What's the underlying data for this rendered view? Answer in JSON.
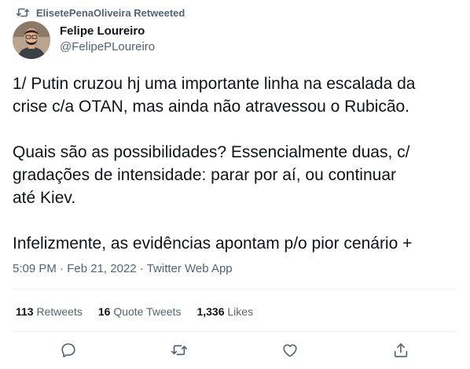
{
  "retweet_context": {
    "text": "ElisetePenaOliveira Retweeted"
  },
  "author": {
    "display_name": "Felipe Loureiro",
    "handle": "@FelipePLoureiro"
  },
  "tweet": {
    "lines": [
      "1/ Putin cruzou hj uma importante linha na escalada da",
      "crise c/a OTAN, mas ainda não atravessou o Rubicão.",
      "Quais são as possibilidades? Essencialmente duas, c/",
      "gradações de intensidade: parar por aí, ou continuar",
      "até Kiev.",
      "Infelizmente, as evidências apontam p/o pior cenário +"
    ]
  },
  "meta": {
    "time": "5:09 PM",
    "separator": "·",
    "date": "Feb 21, 2022",
    "source": "Twitter Web App"
  },
  "stats": {
    "retweets_count": "113",
    "retweets_label": "Retweets",
    "quotes_count": "16",
    "quotes_label": "Quote Tweets",
    "likes_count": "1,336",
    "likes_label": "Likes"
  },
  "icons": {
    "retweet_context": "retweet-icon",
    "reply": "reply-icon",
    "retweet": "retweet-icon",
    "like": "heart-icon",
    "share": "share-icon"
  },
  "colors": {
    "primary_text": "#0f1419",
    "secondary_text": "#536471",
    "divider": "#eff3f4"
  }
}
